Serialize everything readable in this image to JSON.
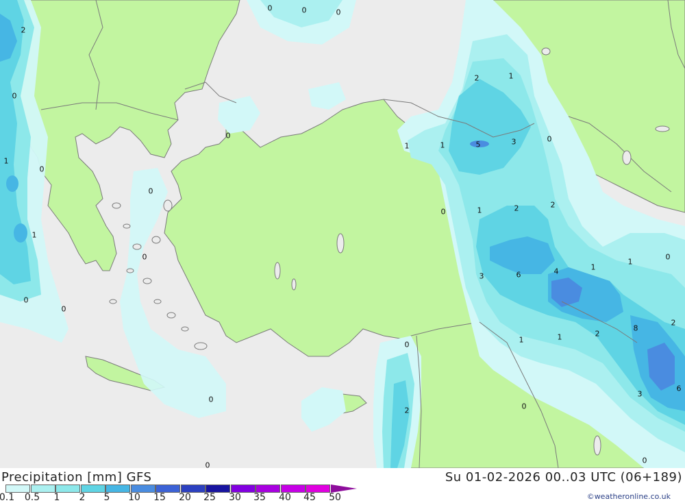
{
  "footer": {
    "title": "Precipitation [mm] GFS",
    "datetime": "Su 01-02-2026 00..03 UTC (06+189)",
    "credit": "©weatheronline.co.uk"
  },
  "legend": {
    "ticks": [
      "0.1",
      "0.5",
      "1",
      "2",
      "5",
      "10",
      "15",
      "20",
      "25",
      "30",
      "35",
      "40",
      "45",
      "50"
    ],
    "colors": [
      "#d2f8f8",
      "#abf0f0",
      "#8de8ea",
      "#5fd4e4",
      "#46b6e4",
      "#4a8ce0",
      "#3c62d6",
      "#2c40c0",
      "#1814a0",
      "#8200e0",
      "#a800e0",
      "#c600e6",
      "#e000e0",
      "#b400b4",
      "#8e0d9c"
    ],
    "arrow_color": "#8e0d9c"
  },
  "map": {
    "colors": {
      "sea": "#ececec",
      "land": "#c2f5a0",
      "border": "#7a7a7a",
      "precip_light": "#d2f8f8",
      "precip_0_5": "#abf0f0",
      "precip_1": "#8de8ea",
      "precip_2": "#5fd4e4",
      "precip_5": "#46b6e4",
      "precip_10": "#4a8ce0"
    },
    "labels": [
      "0",
      "0",
      "0",
      "2",
      "0",
      "1",
      "0",
      "1",
      "0",
      "0",
      "0",
      "0",
      "0",
      "0",
      "2",
      "1",
      "1",
      "1",
      "5",
      "3",
      "0",
      "0",
      "1",
      "2",
      "2",
      "3",
      "6",
      "4",
      "1",
      "1",
      "0",
      "1",
      "1",
      "2",
      "8",
      "2",
      "0",
      "2",
      "0",
      "3",
      "6",
      "0",
      "0"
    ]
  }
}
